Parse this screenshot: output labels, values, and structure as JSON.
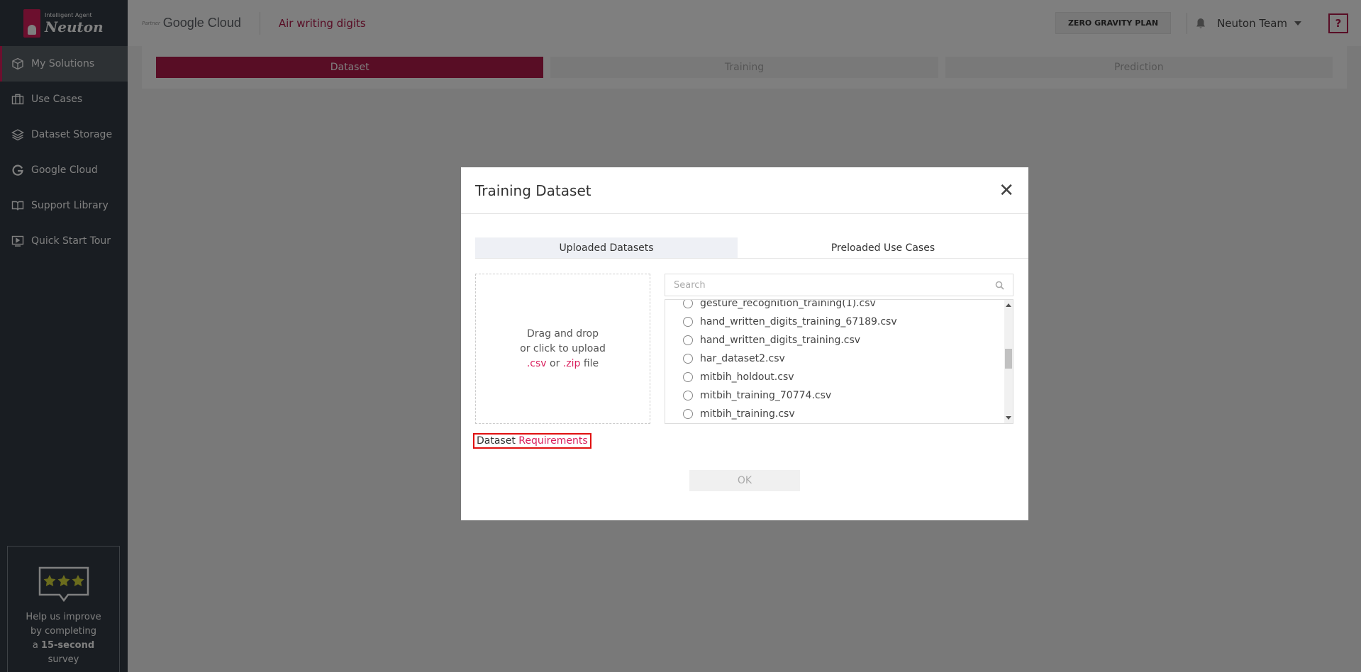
{
  "brand": {
    "sub": "Intelligent Agent",
    "name": "Neuton"
  },
  "sidebar": {
    "items": [
      {
        "label": "My Solutions",
        "icon": "cube-icon"
      },
      {
        "label": "Use Cases",
        "icon": "briefcase-icon"
      },
      {
        "label": "Dataset Storage",
        "icon": "layers-icon"
      },
      {
        "label": "Google Cloud",
        "icon": "google-icon"
      },
      {
        "label": "Support Library",
        "icon": "book-icon"
      },
      {
        "label": "Quick Start Tour",
        "icon": "play-screen-icon"
      }
    ],
    "survey": {
      "line1": "Help us improve",
      "line2": "by completing",
      "line3_prefix": "a",
      "line3_bold": "15-second",
      "line4": "survey"
    }
  },
  "topbar": {
    "partner_label": "Partner",
    "partner_name": "Google Cloud",
    "project_title": "Air writing digits",
    "plan_label": "ZERO GRAVITY PLAN",
    "team_name": "Neuton Team",
    "help_label": "?"
  },
  "steps": [
    "Dataset",
    "Training",
    "Prediction"
  ],
  "modal": {
    "title": "Training Dataset",
    "close": "✕",
    "tabs": [
      "Uploaded Datasets",
      "Preloaded Use Cases"
    ],
    "dropzone": {
      "line1": "Drag and drop",
      "line2": "or click to upload",
      "ext1": ".csv",
      "or": "or",
      "ext2": ".zip",
      "file": "file"
    },
    "search_placeholder": "Search",
    "files": [
      "gesture_recognition_training(1).csv",
      "hand_written_digits_training_67189.csv",
      "hand_written_digits_training.csv",
      "har_dataset2.csv",
      "mitbih_holdout.csv",
      "mitbih_training_70774.csv",
      "mitbih_training.csv"
    ],
    "requirements_prefix": "Dataset",
    "requirements_link": "Requirements",
    "ok_label": "OK"
  },
  "colors": {
    "accent": "#b11b4a",
    "sidebar_bg": "#333b44",
    "highlight_border": "#e01010"
  }
}
